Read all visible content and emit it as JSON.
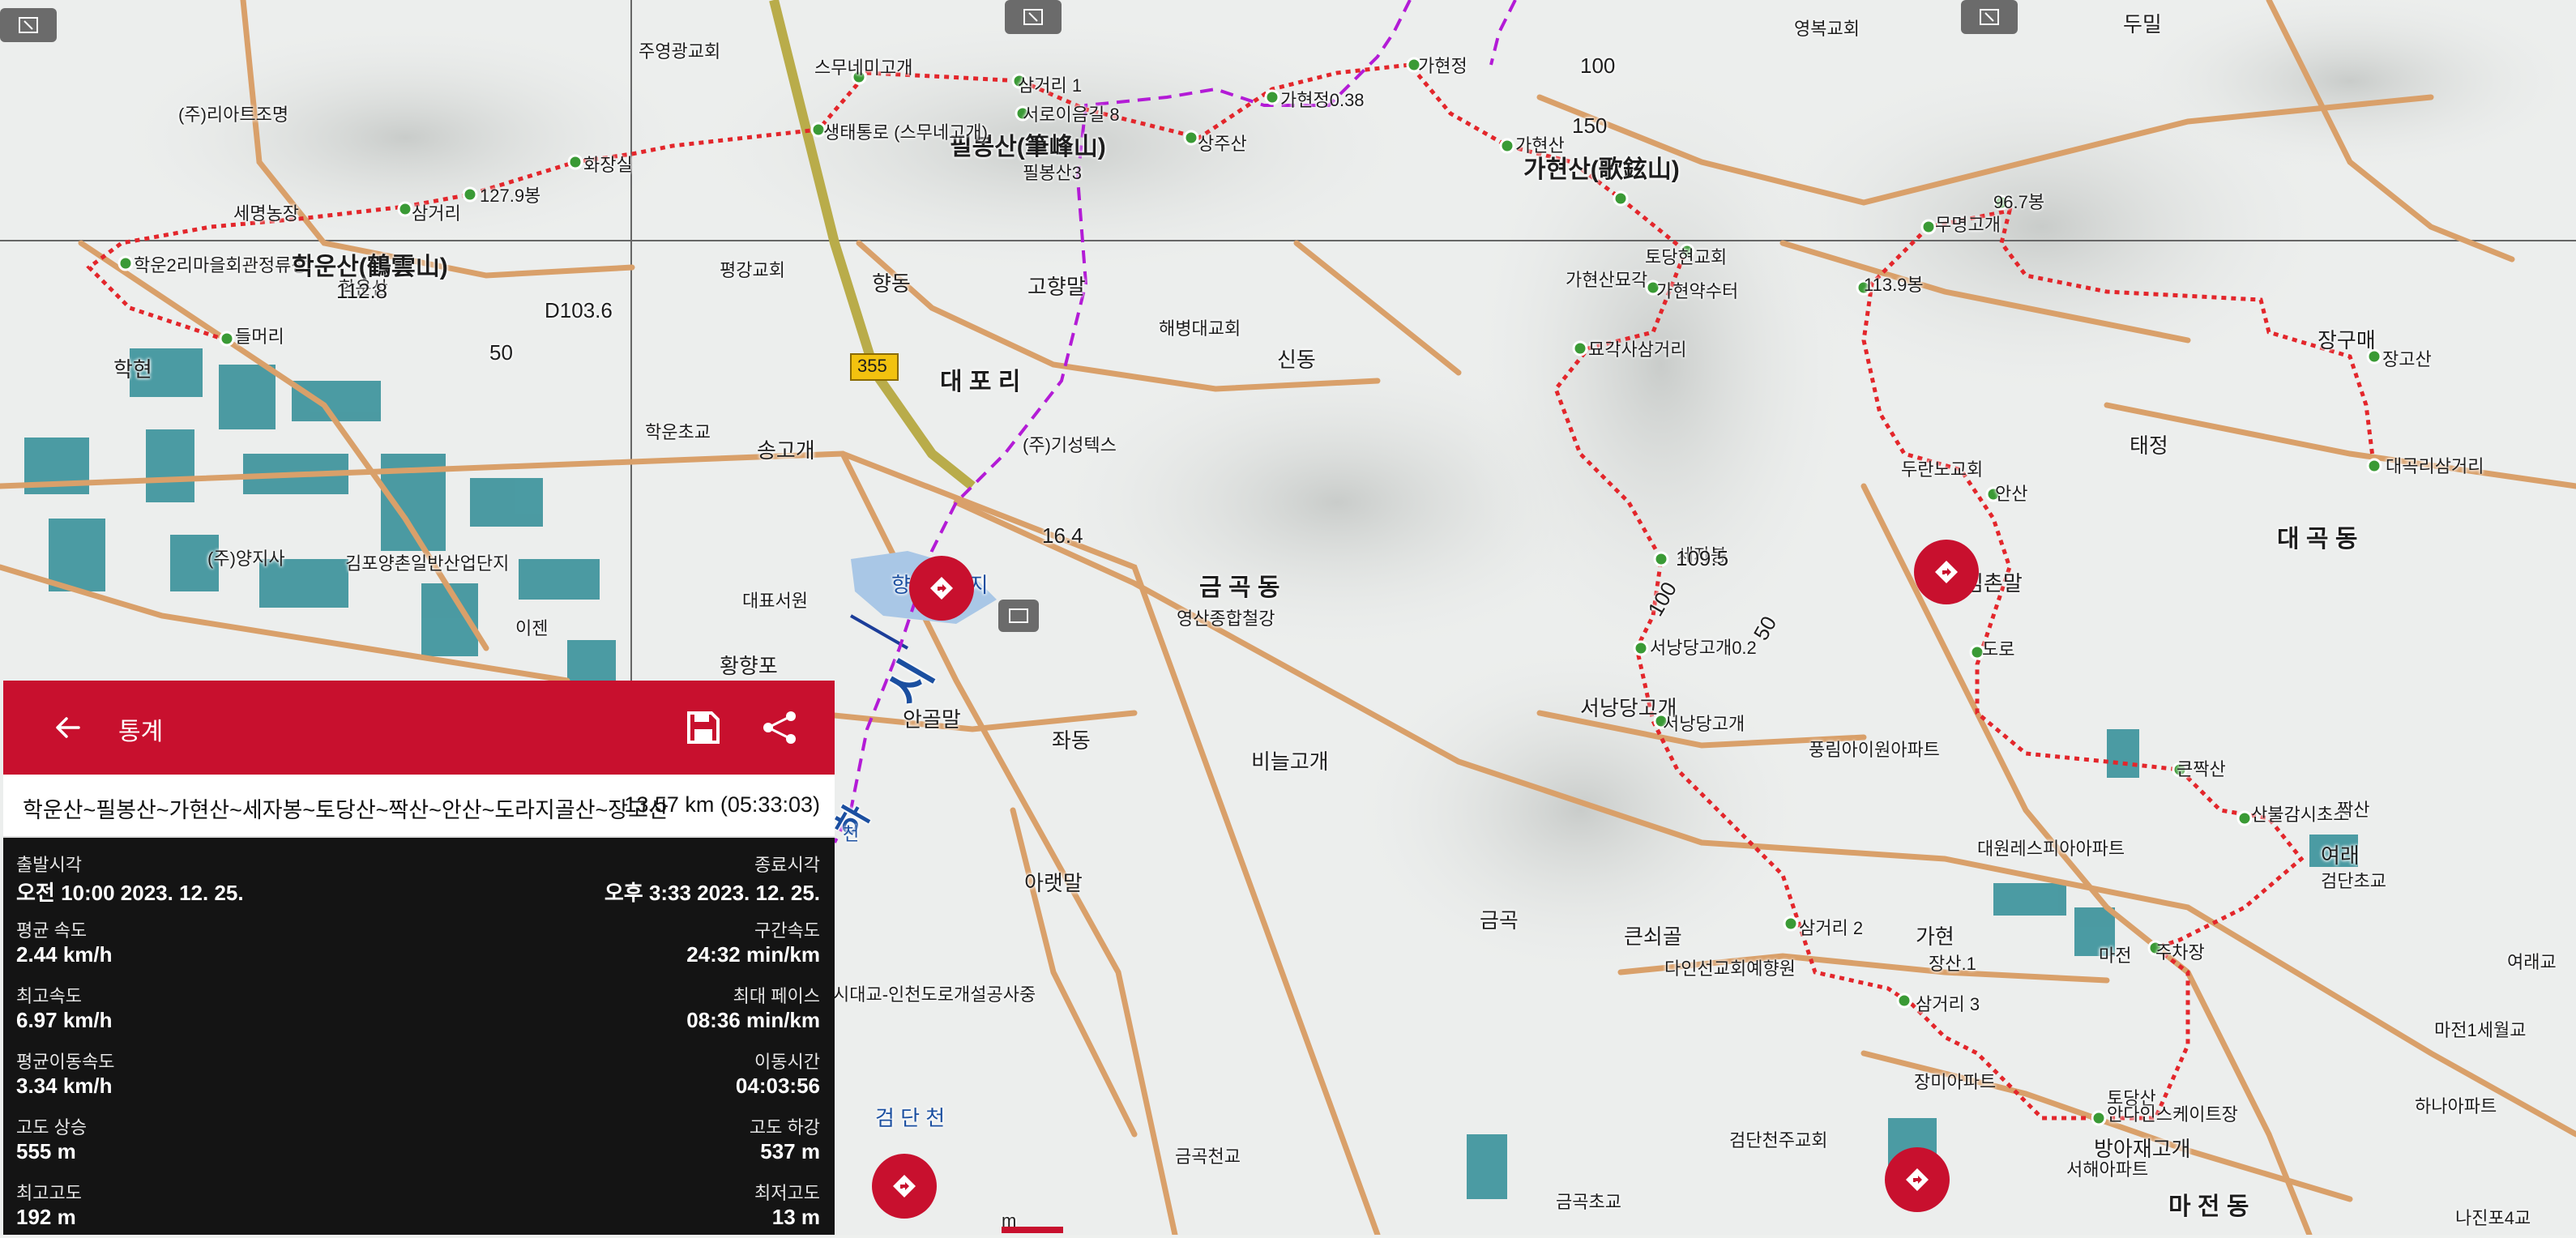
{
  "panel": {
    "title": "통계",
    "route_name": "학운산~필봉산~가현산~세자봉~토당산~짝산~안산~도라지골산~장고산",
    "route_total": "13.57 km (05:33:03)",
    "stats": [
      {
        "left_label": "출발시각",
        "left_value": "오전 10:00 2023. 12. 25.",
        "right_label": "종료시각",
        "right_value": "오후 3:33 2023. 12. 25."
      },
      {
        "left_label": "평균 속도",
        "left_value": "2.44 km/h",
        "right_label": "구간속도",
        "right_value": "24:32 min/km"
      },
      {
        "left_label": "최고속도",
        "left_value": "6.97 km/h",
        "right_label": "최대 페이스",
        "right_value": "08:36 min/km"
      },
      {
        "left_label": "평균이동속도",
        "left_value": "3.34 km/h",
        "right_label": "이동시간",
        "right_value": "04:03:56"
      },
      {
        "left_label": "고도 상승",
        "left_value": "555 m",
        "right_label": "고도 하강",
        "right_value": "537 m"
      },
      {
        "left_label": "최고고도",
        "left_value": "192 m",
        "right_label": "최저고도",
        "right_value": "13 m"
      }
    ]
  },
  "map": {
    "route_color": "#e3262b",
    "boundary_color": "#b31bd6",
    "road_color": "#d9a06a",
    "labels": {
      "l01": "두밀",
      "l02": "영복교회",
      "l03": "주영광교회",
      "l04": "스무네미고개",
      "l05": "삼거리 1",
      "l06": "서로이음길 8",
      "l07": "가현정",
      "l08": "가현정0.38",
      "l09": "100",
      "l10": "필봉산(筆峰山)",
      "l11": "필봉산3",
      "l12": "상주산",
      "l13": "150",
      "l14": "가현산(歌鉉山)",
      "l15": "가현산",
      "l16": "(주)리아트조명",
      "l17": "생태통로 (스무네고개)",
      "l18": "화장실",
      "l19": "127.9봉",
      "l20": "세명농장",
      "l21": "삼거리",
      "l22": "학운2리마을회관정류장",
      "l23": "학운산(鶴雲山)",
      "l24": "학운산",
      "l25": "112.8",
      "l26": "평강교회",
      "l27": "향동",
      "l28": "고향말",
      "l29": "D103.6",
      "l30": "들머리",
      "l31": "학현",
      "l32": "355",
      "l33": "해병대교회",
      "l34": "50",
      "l35": "대 포 리",
      "l36": "신동",
      "l37": "가현산묘각",
      "l38": "가현약수터",
      "l39": "토당현교회",
      "l40": "묘각사삼거리",
      "l41": "무명고개",
      "l42": "96.7봉",
      "l43": "113.9봉",
      "l44": "장구매",
      "l45": "장고산",
      "l46": "태정",
      "l47": "대곡리삼거리",
      "l48": "학운초교",
      "l49": "송고개",
      "l50": "(주)기성텍스",
      "l51": "두란노교회",
      "l52": "안산",
      "l53": "대 곡 동",
      "l54": "(주)양지사",
      "l55": "김포양촌일반산업단지",
      "l56": "16.4",
      "l57": "금 곡 동",
      "l58": "세자봉",
      "l59": "109.5",
      "l60": "김촌말",
      "l61": "대표서원",
      "l62": "영산종합철강",
      "l63": "이젠",
      "l64": "황향포",
      "l65": "도로",
      "l66": "서낭당고개0.2",
      "l67": "100",
      "l68": "50",
      "l69": "시",
      "l70": "안골말",
      "l71": "서낭당고개",
      "l72": "서낭당고개",
      "l73": "좌동",
      "l74": "비늘고개",
      "l75": "풍림아이원아파트",
      "l76": "큰짝산",
      "l77": "산불감시초소",
      "l78": "짝산",
      "l79": "대원레스피아아파트",
      "l80": "여래",
      "l81": "검단초교",
      "l82": "아랫말",
      "l83": "금곡",
      "l84": "큰쇠골",
      "l85": "삼거리 2",
      "l86": "가현",
      "l87": "다인선교회예향원",
      "l88": "마전",
      "l89": "주차장",
      "l90": "여래교",
      "l91": "마전1세월교",
      "l92": "장산.1",
      "l93": "삼거리 3",
      "l94": "시대교-인천도로개설공사중",
      "l95": "장미아파트",
      "l96": "토당산",
      "l97": "안다인스케이트장",
      "l98": "하나아파트",
      "l99": "검 단 천",
      "l100": "금곡천교",
      "l101": "검단천주교회",
      "l102": "방아재고개",
      "l103": "서해아파트",
      "l104": "마 전 동",
      "l105": "금곡초교",
      "l106": "나진포4교",
      "l107": "향산저수지",
      "l108": "m",
      "l109": "하",
      "l110": "천"
    }
  }
}
